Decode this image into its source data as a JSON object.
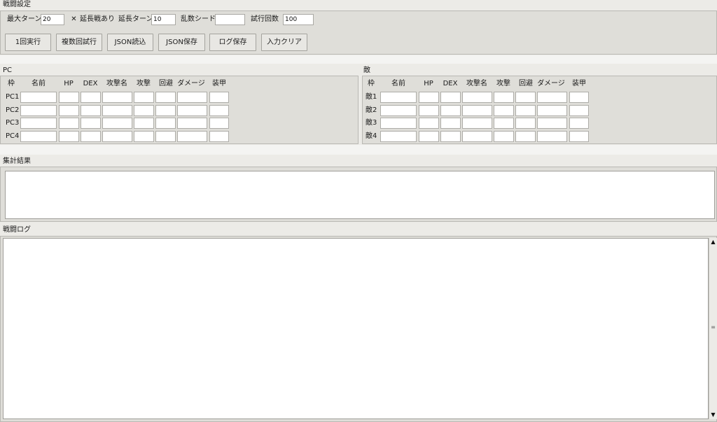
{
  "settings": {
    "group_title": "戦闘設定",
    "max_turns_label": "最大ターン",
    "max_turns_value": "20",
    "extension_checkbox_label": "延長戦あり",
    "extension_checked_mark": "✕",
    "extension_turns_label": "延長ターン",
    "extension_turns_value": "10",
    "random_seed_label": "乱数シード",
    "random_seed_value": "",
    "trial_count_label": "試行回数",
    "trial_count_value": "100"
  },
  "buttons": {
    "run_once": "1回実行",
    "run_multiple": "複数回試行",
    "load_json": "JSON読込",
    "save_json": "JSON保存",
    "save_log": "ログ保存",
    "clear_input": "入力クリア"
  },
  "columns": [
    "枠",
    "名前",
    "HP",
    "DEX",
    "攻撃名",
    "攻撃",
    "回避",
    "ダメージ",
    "装甲"
  ],
  "pc_panel": {
    "title": "PC",
    "rows": [
      "PC1",
      "PC2",
      "PC3",
      "PC4"
    ]
  },
  "enemy_panel": {
    "title": "敵",
    "rows": [
      "敵1",
      "敵2",
      "敵3",
      "敵4"
    ]
  },
  "summary": {
    "title": "集計結果",
    "text": ""
  },
  "battle_log": {
    "title": "戦闘ログ",
    "text": ""
  },
  "icons": {
    "scroll_up": "scroll-up-arrow-icon",
    "scroll_down": "scroll-down-arrow-icon",
    "scroll_grip": "scroll-grip-icon"
  }
}
